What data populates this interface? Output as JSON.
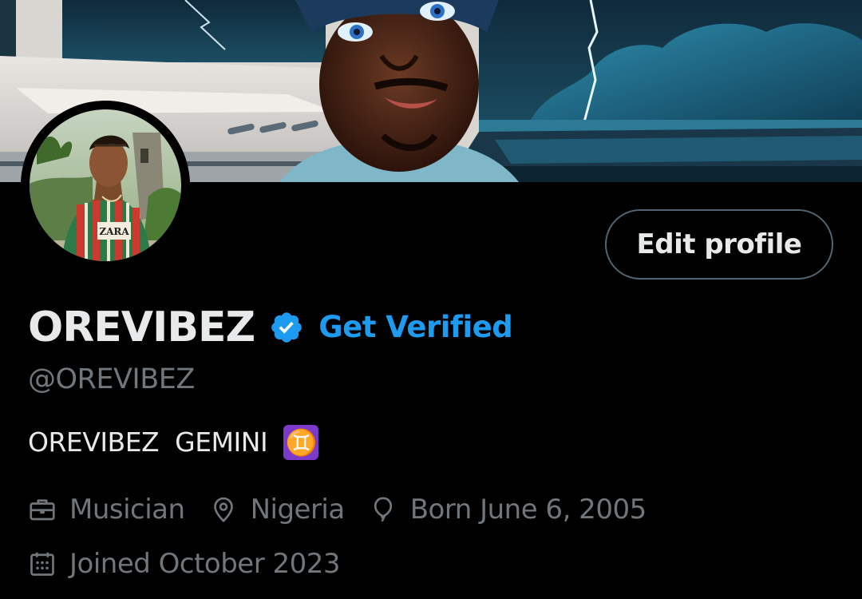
{
  "profile": {
    "display_name": "OREVIBEZ",
    "handle": "@OREVIBEZ",
    "get_verified_label": "Get Verified",
    "edit_profile_label": "Edit profile",
    "bio_text": "OREVIBEZ  GEMINI ",
    "bio_emoji": "♊",
    "profession": "Musician",
    "location": "Nigeria",
    "birthday": "Born June 6, 2005",
    "joined": "Joined October 2023"
  },
  "avatar_shirt_text": "ZARA",
  "icons": {
    "verified": "verified-badge-icon",
    "profession": "briefcase-icon",
    "location": "map-pin-icon",
    "birthday": "balloon-icon",
    "joined": "calendar-icon"
  },
  "colors": {
    "background": "#000000",
    "primary_text": "#e7e9ea",
    "secondary_text": "#71767b",
    "accent": "#1d9bf0",
    "button_border": "#536471",
    "gemini_badge": "#7b3ac9"
  }
}
